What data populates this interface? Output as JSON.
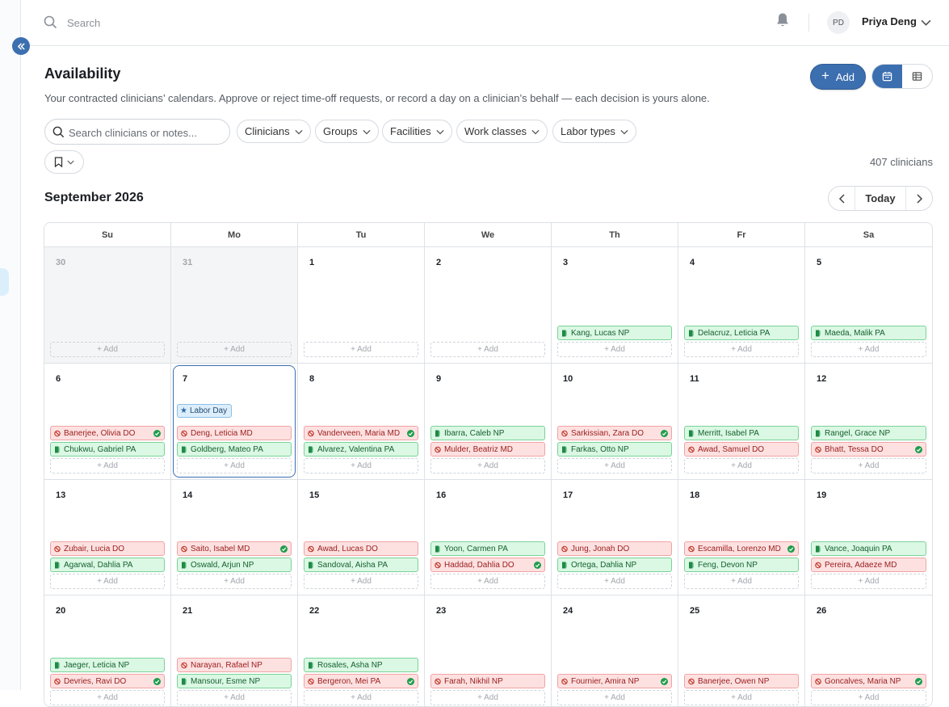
{
  "topbar": {
    "search_placeholder": "Search",
    "user_initials": "PD",
    "user_name": "Priya Deng"
  },
  "page": {
    "title": "Availability",
    "subtitle": "Your contracted clinicians’ calendars. Approve or reject time-off requests, or record a day on a clinician’s behalf — each decision is yours alone.",
    "add_label": "Add",
    "view_modes": [
      "calendar-view",
      "table-view"
    ],
    "active_view": "calendar-view"
  },
  "filters": {
    "search_placeholder": "Search clinicians or notes...",
    "chips": [
      "Clinicians",
      "Groups",
      "Facilities",
      "Work classes",
      "Labor types"
    ],
    "count_label": "407 clinicians"
  },
  "calendar": {
    "month_label": "September 2026",
    "today_label": "Today",
    "weekdays": [
      "Su",
      "Mo",
      "Tu",
      "We",
      "Th",
      "Fr",
      "Sa"
    ],
    "add_slot_label": "+ Add",
    "weeks": [
      [
        {
          "day": "30",
          "out": true,
          "items": []
        },
        {
          "day": "31",
          "out": true,
          "items": []
        },
        {
          "day": "1",
          "items": []
        },
        {
          "day": "2",
          "items": []
        },
        {
          "day": "3",
          "items": [
            {
              "name": "Kang, Lucas NP",
              "type": "available"
            }
          ]
        },
        {
          "day": "4",
          "items": [
            {
              "name": "Delacruz, Leticia PA",
              "type": "available"
            }
          ]
        },
        {
          "day": "5",
          "items": [
            {
              "name": "Maeda, Malik PA",
              "type": "available"
            }
          ]
        }
      ],
      [
        {
          "day": "6",
          "items": [
            {
              "name": "Banerjee, Olivia DO",
              "type": "time-off",
              "approved": true
            },
            {
              "name": "Chukwu, Gabriel PA",
              "type": "available"
            }
          ]
        },
        {
          "day": "7",
          "today": true,
          "holiday": "Labor Day",
          "items": [
            {
              "name": "Deng, Leticia MD",
              "type": "time-off"
            },
            {
              "name": "Goldberg, Mateo PA",
              "type": "available"
            }
          ]
        },
        {
          "day": "8",
          "items": [
            {
              "name": "Vanderveen, Maria MD",
              "type": "time-off",
              "approved": true
            },
            {
              "name": "Alvarez, Valentina PA",
              "type": "available"
            }
          ]
        },
        {
          "day": "9",
          "items": [
            {
              "name": "Ibarra, Caleb NP",
              "type": "available"
            },
            {
              "name": "Mulder, Beatriz MD",
              "type": "time-off"
            }
          ]
        },
        {
          "day": "10",
          "items": [
            {
              "name": "Sarkissian, Zara DO",
              "type": "time-off",
              "approved": true
            },
            {
              "name": "Farkas, Otto NP",
              "type": "available"
            }
          ]
        },
        {
          "day": "11",
          "items": [
            {
              "name": "Merritt, Isabel PA",
              "type": "available"
            },
            {
              "name": "Awad, Samuel DO",
              "type": "time-off"
            }
          ]
        },
        {
          "day": "12",
          "items": [
            {
              "name": "Rangel, Grace NP",
              "type": "available"
            },
            {
              "name": "Bhatt, Tessa DO",
              "type": "time-off",
              "approved": true
            }
          ]
        }
      ],
      [
        {
          "day": "13",
          "items": [
            {
              "name": "Zubair, Lucia DO",
              "type": "time-off"
            },
            {
              "name": "Agarwal, Dahlia PA",
              "type": "available"
            }
          ]
        },
        {
          "day": "14",
          "items": [
            {
              "name": "Saito, Isabel MD",
              "type": "time-off",
              "approved": true
            },
            {
              "name": "Oswald, Arjun NP",
              "type": "available"
            }
          ]
        },
        {
          "day": "15",
          "items": [
            {
              "name": "Awad, Lucas DO",
              "type": "time-off"
            },
            {
              "name": "Sandoval, Aisha PA",
              "type": "available"
            }
          ]
        },
        {
          "day": "16",
          "items": [
            {
              "name": "Yoon, Carmen PA",
              "type": "available"
            },
            {
              "name": "Haddad, Dahlia DO",
              "type": "time-off",
              "approved": true
            }
          ]
        },
        {
          "day": "17",
          "items": [
            {
              "name": "Jung, Jonah DO",
              "type": "time-off"
            },
            {
              "name": "Ortega, Dahlia NP",
              "type": "available"
            }
          ]
        },
        {
          "day": "18",
          "items": [
            {
              "name": "Escamilla, Lorenzo MD",
              "type": "time-off",
              "approved": true
            },
            {
              "name": "Feng, Devon NP",
              "type": "available"
            }
          ]
        },
        {
          "day": "19",
          "items": [
            {
              "name": "Vance, Joaquin PA",
              "type": "available"
            },
            {
              "name": "Pereira, Adaeze MD",
              "type": "time-off"
            }
          ]
        }
      ],
      [
        {
          "day": "20",
          "items": [
            {
              "name": "Jaeger, Leticia NP",
              "type": "available"
            },
            {
              "name": "Devries, Ravi DO",
              "type": "time-off",
              "approved": true
            }
          ]
        },
        {
          "day": "21",
          "items": [
            {
              "name": "Narayan, Rafael NP",
              "type": "time-off"
            },
            {
              "name": "Mansour, Esme NP",
              "type": "available"
            }
          ]
        },
        {
          "day": "22",
          "items": [
            {
              "name": "Rosales, Asha NP",
              "type": "available"
            },
            {
              "name": "Bergeron, Mei PA",
              "type": "time-off",
              "approved": true
            }
          ]
        },
        {
          "day": "23",
          "items": [
            {
              "name": "Farah, Nikhil NP",
              "type": "time-off"
            }
          ]
        },
        {
          "day": "24",
          "items": [
            {
              "name": "Fournier, Amira NP",
              "type": "time-off",
              "approved": true
            }
          ]
        },
        {
          "day": "25",
          "items": [
            {
              "name": "Banerjee, Owen NP",
              "type": "time-off"
            }
          ]
        },
        {
          "day": "26",
          "items": [
            {
              "name": "Goncalves, Maria NP",
              "type": "time-off",
              "approved": true
            }
          ]
        }
      ]
    ]
  },
  "colors": {
    "accent": "#3c6fb0",
    "available_bg": "#dbf8e4",
    "timeoff_bg": "#fde1e1"
  }
}
